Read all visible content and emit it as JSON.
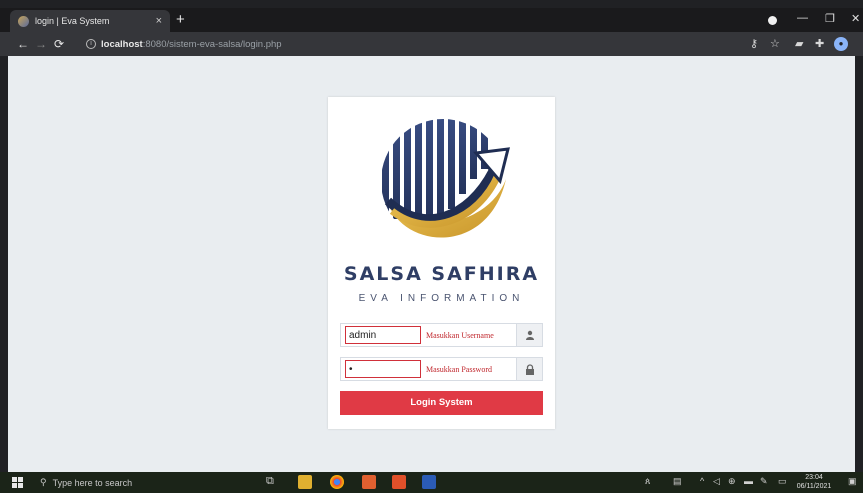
{
  "browser": {
    "tab_title": "login | Eva System",
    "tab_close": "×",
    "new_tab": "+",
    "url_host": "localhost",
    "url_rest": ":8080/sistem-eva-salsa/login.php",
    "window_controls": [
      "—",
      "❐",
      "✕"
    ]
  },
  "login": {
    "brand_title": "SALSA SAFHIRA",
    "brand_subtitle": "EVA INFORMATION",
    "username": {
      "value": "admin",
      "hint": "Masukkan Username",
      "icon": "user-icon"
    },
    "password": {
      "value": "•",
      "hint": "Masukkan Password",
      "icon": "lock-icon"
    },
    "submit_label": "Login System"
  },
  "taskbar": {
    "search_placeholder": "Type here to search",
    "time": "23:04",
    "date": "06/11/2021"
  },
  "colors": {
    "accent": "#e03a45",
    "brand_navy": "#2f3e65",
    "brand_gold": "#d8a838"
  }
}
